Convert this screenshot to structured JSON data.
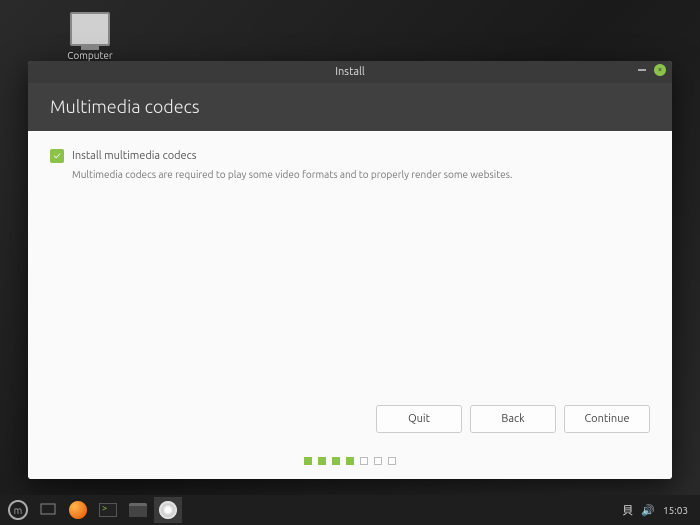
{
  "desktop": {
    "computer_label": "Computer"
  },
  "window": {
    "title": "Install",
    "header": "Multimedia codecs",
    "checkbox_label": "Install multimedia codecs",
    "checkbox_checked": true,
    "description": "Multimedia codecs are required to play some video formats and to properly render some websites.",
    "buttons": {
      "quit": "Quit",
      "back": "Back",
      "continue": "Continue"
    },
    "progress": {
      "done": 4,
      "total": 7
    }
  },
  "taskbar": {
    "clock": "15:03",
    "items": [
      "menu",
      "firefox",
      "terminal",
      "files",
      "installer"
    ]
  },
  "colors": {
    "accent": "#8bc34a",
    "titlebar": "#3a3a3a",
    "header_bg": "#404040"
  }
}
